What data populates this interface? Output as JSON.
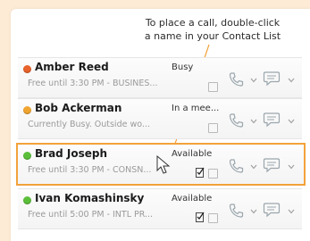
{
  "callout": {
    "line1": "To place a call, double-click",
    "line2": "a name in your Contact List"
  },
  "contacts": [
    {
      "name": "Amber Reed",
      "status": "Busy",
      "note": "Free until 3:30 PM - BUSINES...",
      "presence": "busy"
    },
    {
      "name": "Bob Ackerman",
      "status": "In a mee...",
      "note": "Currently Busy. Outside wo...",
      "presence": "busy-yellow"
    },
    {
      "name": "Brad Joseph",
      "status": "Available",
      "note": "Free until 3:30 PM - CONSN...",
      "presence": "available",
      "selected": true
    },
    {
      "name": "Ivan Komashinsky",
      "status": "Available",
      "note": "Free until 5:00 PM - INTL PR...",
      "presence": "available"
    }
  ],
  "icons": {
    "call": "phone-icon",
    "im": "chat-bubble-icon",
    "dropdown": "chevron-down-icon",
    "note": "note-icon",
    "cursor": "mouse-pointer-icon"
  },
  "colors": {
    "background": "#fdebd5",
    "highlight": "#f2a23b",
    "busy": "#e8622b",
    "away": "#f0a530",
    "available": "#5cbf3a"
  }
}
